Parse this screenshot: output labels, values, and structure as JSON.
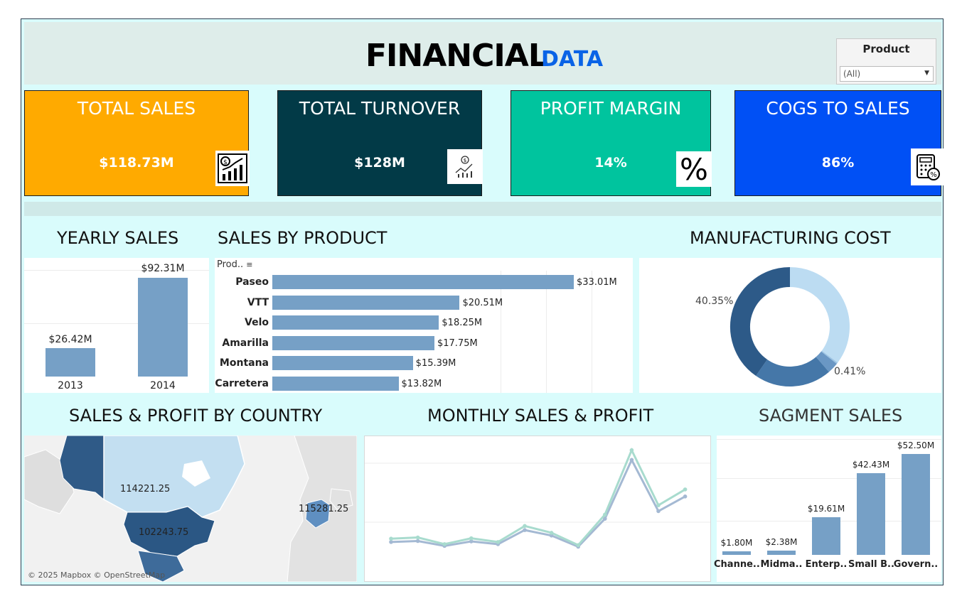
{
  "header": {
    "title_main": "FINANCIAL",
    "title_sub": "DATA"
  },
  "filter": {
    "label": "Product",
    "value": "(All)"
  },
  "kpis": [
    {
      "title": "TOTAL SALES",
      "value": "$118.73M",
      "color": "#ffaa00",
      "icon": "sales-growth-icon"
    },
    {
      "title": "TOTAL TURNOVER",
      "value": "$128M",
      "color": "#023a47",
      "icon": "profit-chart-icon"
    },
    {
      "title": "PROFIT MARGIN",
      "value": "14%",
      "color": "#00c49e",
      "icon": "percent-icon"
    },
    {
      "title": "COGS TO SALES",
      "value": "86%",
      "color": "#0050f5",
      "icon": "calculator-icon"
    }
  ],
  "sections": {
    "yearly": "YEARLY SALES",
    "product": "SALES BY PRODUCT",
    "mfg": "MANUFACTURING COST",
    "country": "SALES & PROFIT BY COUNTRY",
    "monthly": "MONTHLY SALES & PROFIT",
    "segment": "SAGMENT SALES"
  },
  "product_header": "Prod..",
  "map": {
    "credit": "© 2025 Mapbox © OpenStreetMap",
    "labels": [
      "114221.25",
      "102243.75",
      "115281.25"
    ]
  },
  "chart_data": [
    {
      "type": "bar",
      "title": "YEARLY SALES",
      "categories": [
        "2013",
        "2014"
      ],
      "values": [
        26.42,
        92.31
      ],
      "labels": [
        "$26.42M",
        "$92.31M"
      ]
    },
    {
      "type": "bar",
      "title": "SALES BY PRODUCT",
      "orientation": "horizontal",
      "categories": [
        "Paseo",
        "VTT",
        "Velo",
        "Amarilla",
        "Montana",
        "Carretera"
      ],
      "values": [
        33.01,
        20.51,
        18.25,
        17.75,
        15.39,
        13.82
      ],
      "labels": [
        "$33.01M",
        "$20.51M",
        "$18.25M",
        "$17.75M",
        "$15.39M",
        "$13.82M"
      ]
    },
    {
      "type": "pie",
      "title": "MANUFACTURING COST",
      "values": [
        40.35,
        21,
        3,
        0.41,
        35.24
      ],
      "labels": [
        "40.35%",
        "",
        "",
        "0.41%",
        ""
      ],
      "colors": [
        "#2d5a88",
        "#4577a8",
        "#6a97c4",
        "#9cc4e4",
        "#bcdcf2"
      ]
    },
    {
      "type": "line",
      "title": "MONTHLY SALES & PROFIT",
      "series": [
        {
          "values": [
            9.5,
            10.0,
            7.5,
            9.8,
            8.4,
            15.6,
            12.8,
            7.1,
            21.4,
            51.5,
            25.3,
            32.8
          ],
          "color": "#a4b9d3"
        },
        {
          "values": [
            11.2,
            11.8,
            8.4,
            11.4,
            9.5,
            17.7,
            14.2,
            7.9,
            23.5,
            56.5,
            28.3,
            36.4
          ],
          "color": "#a8dbce"
        }
      ]
    },
    {
      "type": "bar",
      "title": "SAGMENT SALES",
      "categories": [
        "Channe..",
        "Midma..",
        "Enterp..",
        "Small B..",
        "Govern.."
      ],
      "values": [
        1.8,
        2.38,
        19.61,
        42.43,
        52.5
      ],
      "labels": [
        "$1.80M",
        "$2.38M",
        "$19.61M",
        "$42.43M",
        "$52.50M"
      ]
    }
  ]
}
